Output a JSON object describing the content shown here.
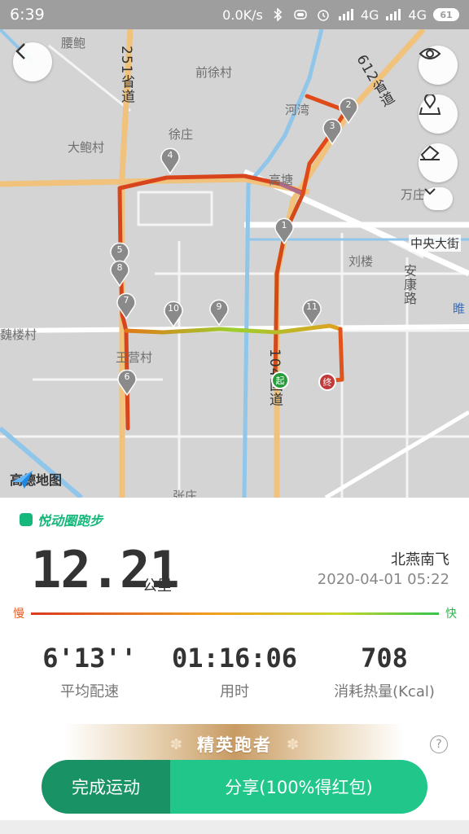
{
  "status_bar": {
    "time": "6:39",
    "network_speed": "0.0K/s",
    "signal_1": "4G",
    "signal_2": "4G",
    "battery": "61"
  },
  "map": {
    "place_labels": [
      "腰鲍",
      "前徐村",
      "大鲍村",
      "徐庄",
      "河湾",
      "高塘",
      "万庄",
      "刘楼",
      "魏楼村",
      "王营村",
      "张庄",
      "中央大街",
      "安康路",
      "睢"
    ],
    "road_labels": [
      "251省道",
      "612省道",
      "104国道"
    ],
    "markers": [
      "1",
      "2",
      "3",
      "4",
      "5",
      "6",
      "7",
      "8",
      "9",
      "10",
      "11"
    ],
    "start_label": "起",
    "end_label": "终",
    "provider": "高德地图",
    "controls": [
      "back-icon",
      "eye-icon",
      "map-pin-icon",
      "eraser-icon",
      "chevron-down-icon"
    ]
  },
  "summary": {
    "app_name": "悦动圈跑步",
    "distance": "12.21",
    "distance_unit": "公里",
    "user_name": "北燕南飞",
    "datetime": "2020-04-01 05:22",
    "pace_slow_label": "慢",
    "pace_fast_label": "快",
    "stats": [
      {
        "value": "6'13''",
        "label": "平均配速"
      },
      {
        "value": "01:16:06",
        "label": "用时"
      },
      {
        "value": "708",
        "label": "消耗热量(Kcal)"
      }
    ],
    "badge": "精英跑者",
    "help": "?",
    "finish_button": "完成运动",
    "share_button": "分享(100%得红包)"
  },
  "colors": {
    "accent_green": "#20c68a",
    "dark_green": "#199365",
    "route_slow": "#d93b1e",
    "route_fast": "#36c44c"
  }
}
